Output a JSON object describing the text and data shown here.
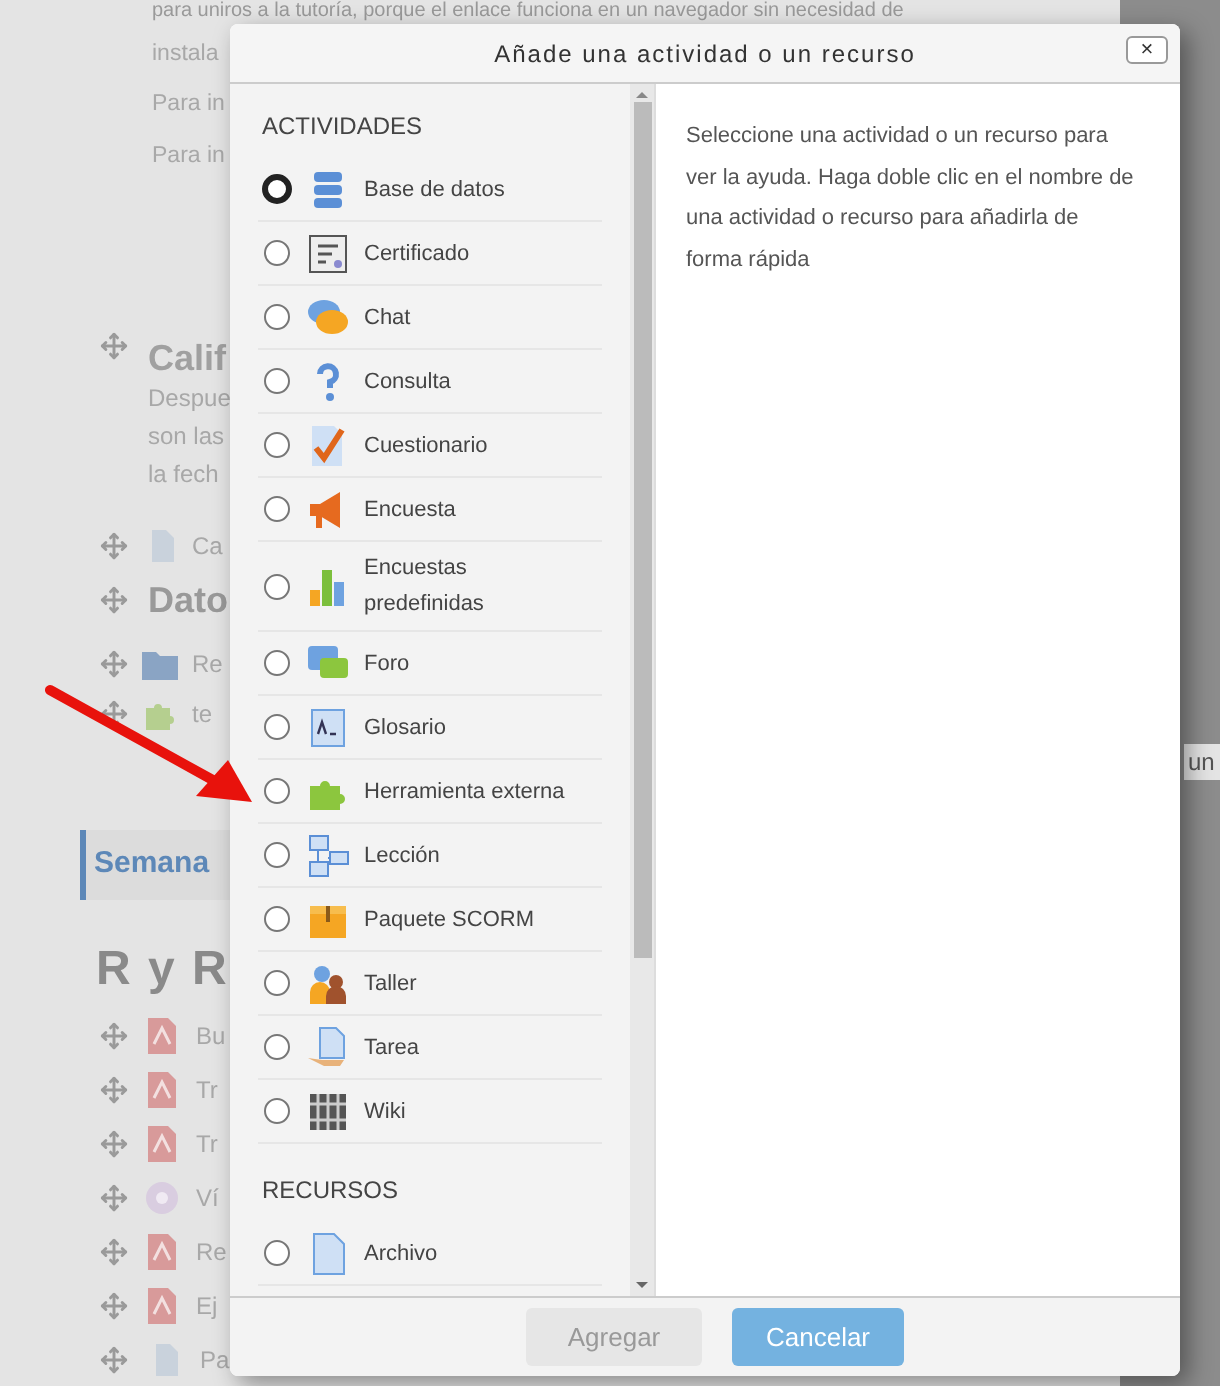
{
  "page": {
    "intro_lines": [
      "para uniros a la tutoría, porque el enlace funciona en un navegador sin necesidad de",
      "instala",
      "Para in",
      "Para in"
    ],
    "grading": {
      "title": "Calif",
      "lines": [
        "Despue",
        "son las",
        "la fech"
      ]
    },
    "grading_item": "Ca",
    "data_title": "Dato",
    "data_items": [
      "Re",
      "te"
    ],
    "week_tab": "Semana",
    "section_title": "R y R",
    "section_items": [
      "Bu",
      "Tr",
      "Tr",
      "Ví",
      "Re",
      "Ej",
      "Pa"
    ],
    "right_fragment": "un"
  },
  "dialog": {
    "title": "Añade una actividad o un recurso",
    "close": "×",
    "sections": [
      {
        "heading": "ACTIVIDADES",
        "items": [
          {
            "label": "Base de datos",
            "focused": true
          },
          {
            "label": "Certificado",
            "focused": false
          },
          {
            "label": "Chat",
            "focused": false
          },
          {
            "label": "Consulta",
            "focused": false
          },
          {
            "label": "Cuestionario",
            "focused": false
          },
          {
            "label": "Encuesta",
            "focused": false
          },
          {
            "label": "Encuestas predefinidas",
            "focused": false
          },
          {
            "label": "Foro",
            "focused": false
          },
          {
            "label": "Glosario",
            "focused": false
          },
          {
            "label": "Herramienta externa",
            "focused": false
          },
          {
            "label": "Lección",
            "focused": false
          },
          {
            "label": "Paquete SCORM",
            "focused": false
          },
          {
            "label": "Taller",
            "focused": false
          },
          {
            "label": "Tarea",
            "focused": false
          },
          {
            "label": "Wiki",
            "focused": false
          }
        ]
      },
      {
        "heading": "RECURSOS",
        "items": [
          {
            "label": "Archivo",
            "focused": false
          }
        ]
      }
    ],
    "help": "Seleccione una actividad o un recurso para ver la ayuda. Haga doble clic en el nombre de una actividad o recurso para añadirla de forma rápida",
    "buttons": [
      {
        "label": "Agregar",
        "disabled": true
      },
      {
        "label": "Cancelar",
        "disabled": false
      }
    ]
  }
}
